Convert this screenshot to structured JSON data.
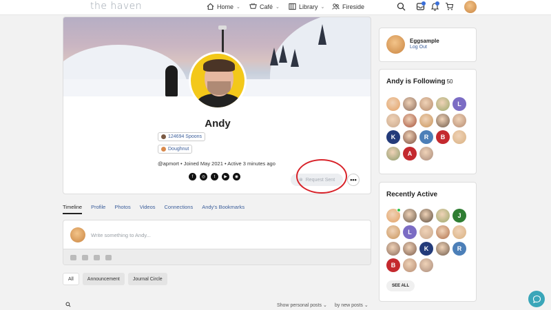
{
  "nav": {
    "logo": "the haven",
    "items": [
      {
        "label": "Home",
        "icon": "home-icon"
      },
      {
        "label": "Café",
        "icon": "cafe-icon"
      },
      {
        "label": "Library",
        "icon": "library-icon"
      },
      {
        "label": "Fireside",
        "icon": "fireside-icon"
      }
    ]
  },
  "profile": {
    "name": "Andy",
    "badges": [
      {
        "label": "124694 Spoons",
        "dot_color": "#7a5a44"
      },
      {
        "label": "Doughnut",
        "dot_color": "#d98a4c"
      }
    ],
    "meta": "@apmort • Joined May 2021 • Active 3 minutes ago",
    "request_button": "Request Sent",
    "more_button": "•••"
  },
  "tabs": [
    "Timeline",
    "Profile",
    "Photos",
    "Videos",
    "Connections",
    "Andy's Bookmarks"
  ],
  "composer": {
    "placeholder": "Write something to Andy..."
  },
  "filters": [
    "All",
    "Announcement",
    "Journal Circle"
  ],
  "sort": {
    "show": "Show personal posts",
    "by": "by new posts"
  },
  "sidebar": {
    "user": {
      "name": "Eggsample",
      "logout": "Log Out"
    },
    "following": {
      "title": "Andy is Following",
      "count": "50",
      "avatars": [
        {
          "letter": "",
          "color": "#e3a062"
        },
        {
          "letter": "",
          "color": "#8a6a5a"
        },
        {
          "letter": "",
          "color": "#b58a6a"
        },
        {
          "letter": "",
          "color": "#9aa86a"
        },
        {
          "letter": "L",
          "color": "#7b6cc4"
        },
        {
          "letter": "",
          "color": "#c9a88c"
        },
        {
          "letter": "",
          "color": "#a5503a"
        },
        {
          "letter": "",
          "color": "#c8945a"
        },
        {
          "letter": "",
          "color": "#6e5a4a"
        },
        {
          "letter": "",
          "color": "#b58a70"
        },
        {
          "letter": "K",
          "color": "#233b7a"
        },
        {
          "letter": "",
          "color": "#7a4a3a"
        },
        {
          "letter": "R",
          "color": "#4c7fb8"
        },
        {
          "letter": "B",
          "color": "#c4292e"
        },
        {
          "letter": "",
          "color": "#d8b080"
        },
        {
          "letter": "",
          "color": "#8a9a6a"
        },
        {
          "letter": "A",
          "color": "#c4292e"
        },
        {
          "letter": "",
          "color": "#a88a7a"
        }
      ]
    },
    "recent": {
      "title": "Recently Active",
      "see_all": "SEE ALL",
      "avatars": [
        {
          "letter": "",
          "color": "#e3a062",
          "online": true
        },
        {
          "letter": "",
          "color": "#6a5a4a",
          "online": false
        },
        {
          "letter": "",
          "color": "#5a4a3a",
          "online": false
        },
        {
          "letter": "",
          "color": "#9aa86a",
          "online": false
        },
        {
          "letter": "J",
          "color": "#2e7d32",
          "online": false
        },
        {
          "letter": "",
          "color": "#c8945a",
          "online": false
        },
        {
          "letter": "L",
          "color": "#7b6cc4",
          "online": false
        },
        {
          "letter": "",
          "color": "#c9a88c",
          "online": false
        },
        {
          "letter": "",
          "color": "#b0704a",
          "online": false
        },
        {
          "letter": "",
          "color": "#d8b080",
          "online": false
        },
        {
          "letter": "",
          "color": "#8a6a5a",
          "online": false
        },
        {
          "letter": "",
          "color": "#7a5a4a",
          "online": false
        },
        {
          "letter": "K",
          "color": "#233b7a",
          "online": false
        },
        {
          "letter": "",
          "color": "#6e5a4a",
          "online": false
        },
        {
          "letter": "R",
          "color": "#4c7fb8",
          "online": false
        },
        {
          "letter": "B",
          "color": "#c4292e",
          "online": false
        },
        {
          "letter": "",
          "color": "#b58a70",
          "online": false
        },
        {
          "letter": "",
          "color": "#a88a7a",
          "online": false
        }
      ]
    }
  }
}
